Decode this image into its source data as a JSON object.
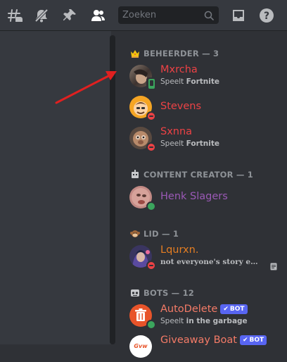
{
  "search": {
    "placeholder": "Zoeken"
  },
  "colors": {
    "beheerder": "#ed4245",
    "content_creator": "#9b59b6",
    "lid": "#e67e22",
    "bots": "#f47b67",
    "bot_badge": "#5865f2",
    "annotation_arrow": "#e02020"
  },
  "groups": [
    {
      "title": "BEHEERDER — 3",
      "icon": "crown-icon",
      "members": [
        {
          "name": "Mxrcha",
          "activity_prefix": "Speelt",
          "activity_game": "Fortnite",
          "status": "mobile-online"
        },
        {
          "name": "Stevens",
          "status": "dnd"
        },
        {
          "name": "Sxnna",
          "activity_prefix": "Speelt",
          "activity_game": "Fortnite",
          "status": "dnd"
        }
      ]
    },
    {
      "title": "CONTENT CREATOR — 1",
      "icon": "robot-icon",
      "members": [
        {
          "name": "Henk Slagers",
          "status": "online"
        }
      ]
    },
    {
      "title": "LID — 1",
      "icon": "monkey-icon",
      "members": [
        {
          "name": "Lqurxn.",
          "custom_status": "not everyone's story en...",
          "status": "dnd"
        }
      ]
    },
    {
      "title": "BOTS — 12",
      "icon": "bot-face-icon",
      "members": [
        {
          "name": "AutoDelete",
          "badge": "BOT",
          "activity_prefix": "Speelt",
          "activity_game": "in the garbage",
          "status": "online"
        },
        {
          "name": "Giveaway Boat",
          "badge": "BOT",
          "status": "online"
        }
      ]
    }
  ]
}
